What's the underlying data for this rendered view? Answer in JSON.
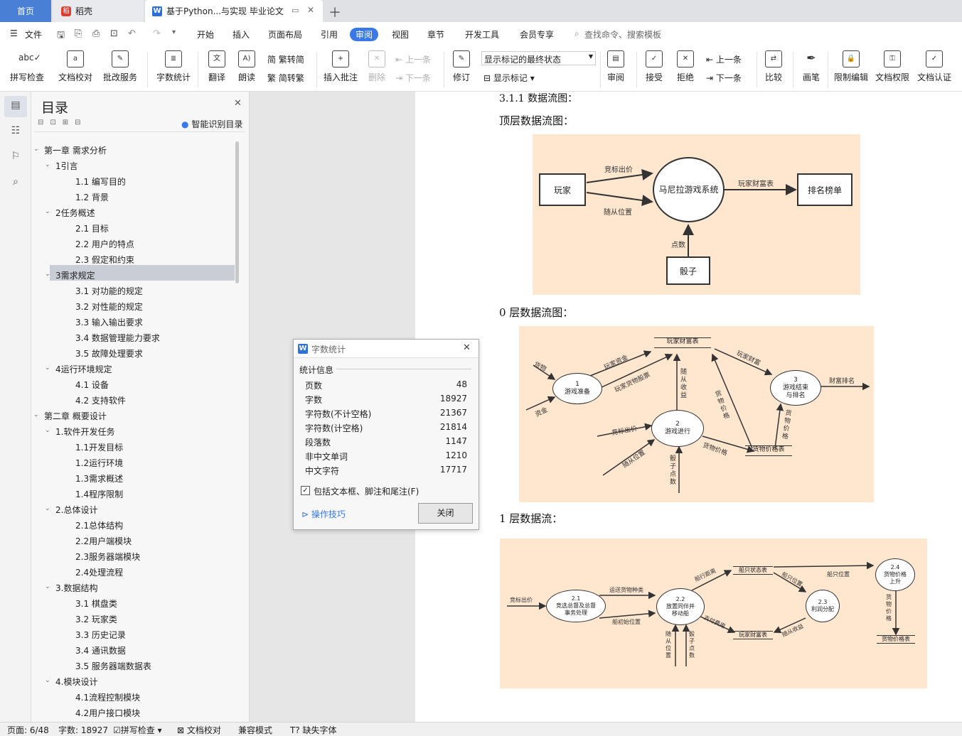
{
  "tabs": {
    "home": "首页",
    "daoke": "稻壳",
    "doc": "基于Python...与实现 毕业论文"
  },
  "menu": {
    "file": "文件",
    "items": [
      "开始",
      "插入",
      "页面布局",
      "引用",
      "审阅",
      "视图",
      "章节",
      "开发工具",
      "会员专享"
    ],
    "search": "查找命令、搜索模板"
  },
  "ribbon": {
    "spell": "拼写检查",
    "proof": "文档校对",
    "annot": "批改服务",
    "wordcount": "字数统计",
    "translate": "翻译",
    "read": "朗读",
    "t2s": "繁转简",
    "s2t": "简转繁",
    "insert_comment": "插入批注",
    "delete": "删除",
    "prev_c": "上一条",
    "next_c": "下一条",
    "revise": "修订",
    "markup_select": "显示标记的最终状态",
    "show_markup": "显示标记",
    "review": "审阅",
    "accept": "接受",
    "reject": "拒绝",
    "prev": "上一条",
    "next": "下一条",
    "compare": "比较",
    "pen": "画笔",
    "restrict": "限制编辑",
    "doc_perm": "文档权限",
    "doc_cert": "文档认证"
  },
  "toc": {
    "title": "目录",
    "smart": "智能识别目录",
    "items": [
      {
        "t": "第一章  需求分析",
        "l": 0
      },
      {
        "t": "1引言",
        "l": 1
      },
      {
        "t": "1.1 编写目的",
        "l": 2
      },
      {
        "t": "1.2 背景",
        "l": 2
      },
      {
        "t": "2任务概述",
        "l": 1
      },
      {
        "t": "2.1 目标",
        "l": 2
      },
      {
        "t": "2.2 用户的特点",
        "l": 2
      },
      {
        "t": "2.3 假定和约束",
        "l": 2
      },
      {
        "t": "3需求规定",
        "l": 1
      },
      {
        "t": "3.1 对功能的规定",
        "l": 2
      },
      {
        "t": "3.2 对性能的规定",
        "l": 2
      },
      {
        "t": "3.3 输入输出要求",
        "l": 2
      },
      {
        "t": "3.4 数据管理能力要求",
        "l": 2
      },
      {
        "t": "3.5 故障处理要求",
        "l": 2
      },
      {
        "t": "4运行环境规定",
        "l": 1
      },
      {
        "t": "4.1 设备",
        "l": 2
      },
      {
        "t": "4.2 支持软件",
        "l": 2
      },
      {
        "t": "第二章  概要设计",
        "l": 0
      },
      {
        "t": "1.软件开发任务",
        "l": 1
      },
      {
        "t": "1.1开发目标",
        "l": 2
      },
      {
        "t": "1.2运行环境",
        "l": 2
      },
      {
        "t": "1.3需求概述",
        "l": 2
      },
      {
        "t": "1.4程序限制",
        "l": 2
      },
      {
        "t": "2.总体设计",
        "l": 1
      },
      {
        "t": "2.1总体结构",
        "l": 2
      },
      {
        "t": "2.2用户端模块",
        "l": 2
      },
      {
        "t": "2.3服务器端模块",
        "l": 2
      },
      {
        "t": "2.4处理流程",
        "l": 2
      },
      {
        "t": "3.数据结构",
        "l": 1
      },
      {
        "t": "3.1  棋盘类",
        "l": 2
      },
      {
        "t": "3.2  玩家类",
        "l": 2
      },
      {
        "t": "3.3  历史记录",
        "l": 2
      },
      {
        "t": "3.4  通讯数据",
        "l": 2
      },
      {
        "t": "3.5  服务器端数据表",
        "l": 2
      },
      {
        "t": "4.模块设计",
        "l": 1
      },
      {
        "t": "4.1流程控制模块",
        "l": 2
      },
      {
        "t": "4.2用户接口模块",
        "l": 2
      }
    ]
  },
  "doc": {
    "heading311": "3.1.1  数据流图：",
    "top_title": "顶层数据流图：",
    "l0_title": "0 层数据流图：",
    "l1_title": "1 层数据流："
  },
  "d1": {
    "player": "玩家",
    "system": "马尼拉游戏系统",
    "rank": "排名榜单",
    "dice": "骰子",
    "bid": "竞标出价",
    "pos": "随从位置",
    "wealth": "玩家财富表",
    "points": "点数"
  },
  "d2": {
    "store_wealth": "玩家财富表",
    "store_price": "货物价格表",
    "p1": "1\n游戏准备",
    "p2": "2\n游戏进行",
    "p3": "3\n游戏结束\n与排名",
    "goods": "货物",
    "cash": "资金",
    "pcash": "玩家资金",
    "pshares": "玩家货物股票",
    "wealthlbl": "玩家财富",
    "rankout": "财富排名",
    "bid": "竞标出价",
    "pos": "随从位置",
    "dicepts": "骰\n子\n点\n数",
    "follow": "随\n从\n收\n益",
    "gprice": "货\n物\n价\n格",
    "gprice2": "货\n物\n价\n格",
    "gpricelbl": "货物价格"
  },
  "d3": {
    "p21": "2.1\n竞选总督及总督\n事务处理",
    "p22": "2.2\n放置同伴并\n移动船",
    "p23": "2.3\n利润分配",
    "p24": "2.4\n货物价格\n上升",
    "bidin": "竞标出价",
    "ship_kind": "运送货物种类",
    "ship_init": "船初始位置",
    "distance": "船行距离",
    "ship_state": "船只状态表",
    "ship_pos": "船只位置",
    "ship_pos2": "船只位置",
    "pay": "支付费用",
    "wealth": "玩家财富表",
    "follow_gain": "随从收益",
    "price_store": "货物价格表",
    "gprice": "货\n物\n价\n格",
    "follow_pos": "随\n从\n位\n置",
    "dice": "骰\n子\n点\n数"
  },
  "dialog": {
    "title": "字数统计",
    "section": "统计信息",
    "rows": [
      {
        "k": "页数",
        "v": "48"
      },
      {
        "k": "字数",
        "v": "18927"
      },
      {
        "k": "字符数(不计空格)",
        "v": "21367"
      },
      {
        "k": "字符数(计空格)",
        "v": "21814"
      },
      {
        "k": "段落数",
        "v": "1147"
      },
      {
        "k": "非中文单词",
        "v": "1210"
      },
      {
        "k": "中文字符",
        "v": "17717"
      }
    ],
    "checkbox": "包括文本框、脚注和尾注(F)",
    "tips": "操作技巧",
    "close": "关闭"
  },
  "status": {
    "page": "页面: 6/48",
    "words": "字数: 18927",
    "spell": "拼写检查",
    "proof": "文档校对",
    "compat": "兼容模式",
    "font": "缺失字体"
  }
}
